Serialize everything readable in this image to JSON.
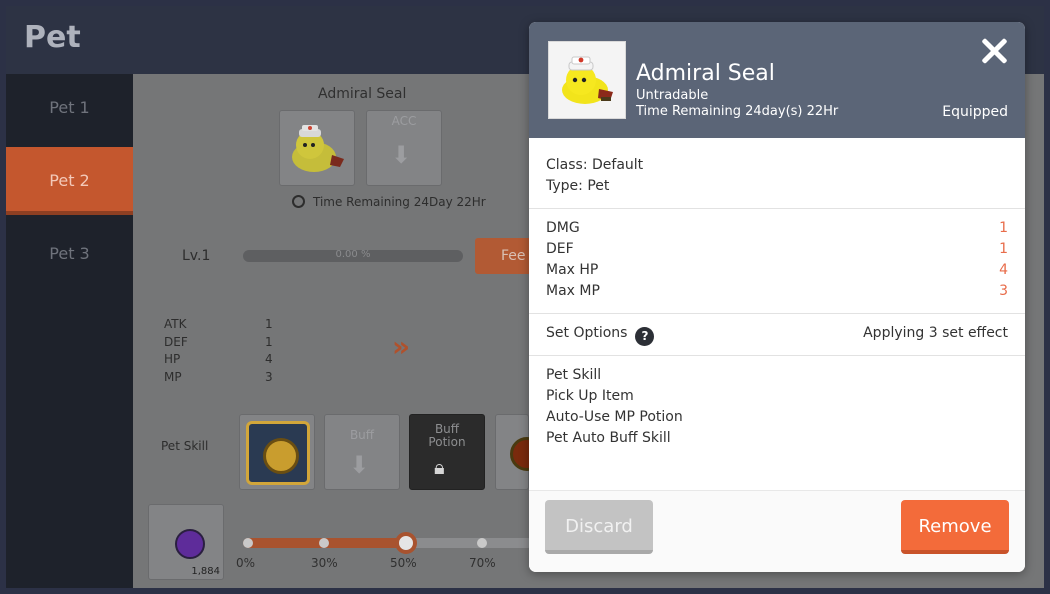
{
  "window": {
    "title": "Pet"
  },
  "sidebar": {
    "items": [
      {
        "label": "Pet 1",
        "active": false
      },
      {
        "label": "Pet 2",
        "active": true
      },
      {
        "label": "Pet 3",
        "active": false
      }
    ]
  },
  "background": {
    "pet_name": "Admiral Seal",
    "acc_slot_label": "ACC",
    "time_remaining": "Time Remaining  24Day 22Hr",
    "level": "Lv.1",
    "exp_text": "0.00 %",
    "feed_label": "Fee",
    "stats": {
      "labels": [
        "ATK",
        "DEF",
        "HP",
        "MP"
      ],
      "values": [
        "1",
        "1",
        "4",
        "3"
      ]
    },
    "pet_skill_label": "Pet Skill",
    "buff_slot_label": "Buff",
    "buff_potion_label": "Buff Potion",
    "potion_count": "1,884",
    "slider": {
      "ticks": [
        "0%",
        "30%",
        "50%",
        "70%"
      ],
      "value_percent": 50
    }
  },
  "modal": {
    "name": "Admiral Seal",
    "tradability": "Untradable",
    "time_remaining": "Time Remaining 24day(s) 22Hr",
    "equipped": "Equipped",
    "class_line": "Class: Default",
    "type_line": "Type: Pet",
    "stats": [
      {
        "label": "DMG",
        "value": "1"
      },
      {
        "label": "DEF",
        "value": "1"
      },
      {
        "label": "Max HP",
        "value": "4"
      },
      {
        "label": "Max MP",
        "value": "3"
      }
    ],
    "set_options_label": "Set Options",
    "set_options_value": "Applying 3 set effect",
    "skills": [
      "Pet Skill",
      "Pick Up Item",
      "Auto-Use MP Potion",
      "Pet Auto Buff Skill"
    ],
    "discard_label": "Discard",
    "remove_label": "Remove"
  },
  "colors": {
    "accent": "#f36b3a",
    "stat_value": "#e86c4a",
    "header": "#5b6577"
  }
}
